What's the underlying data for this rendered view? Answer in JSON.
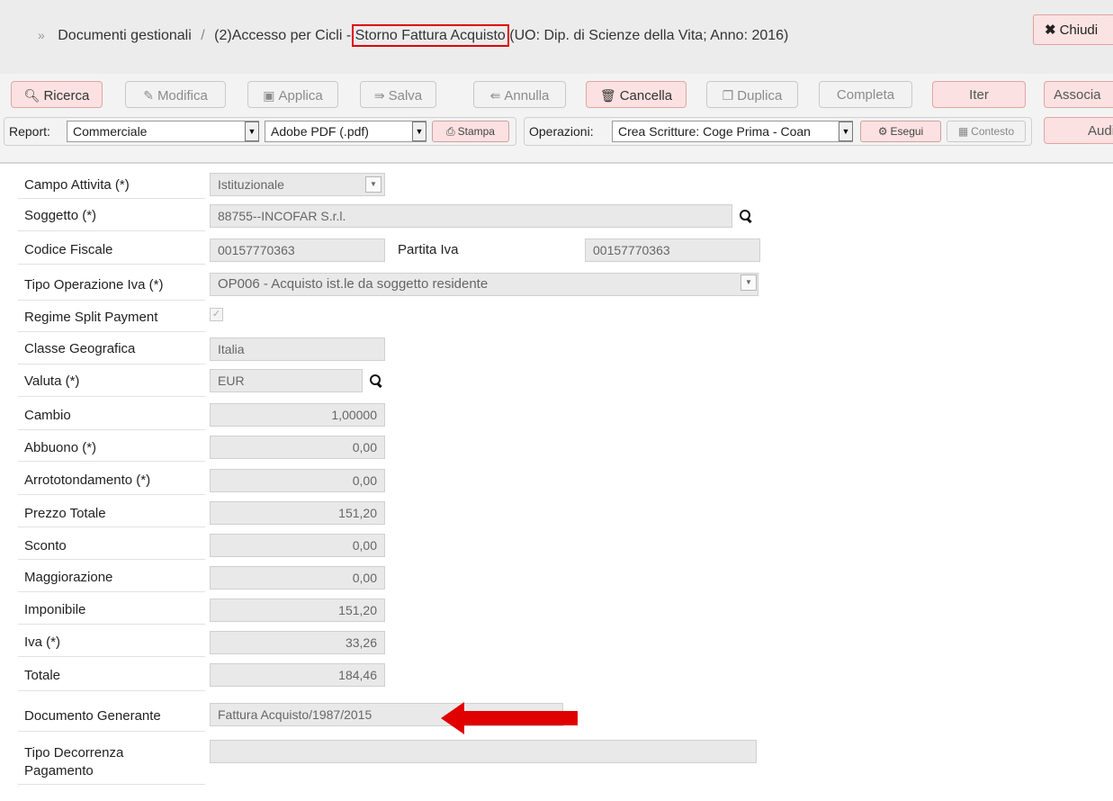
{
  "header": {
    "chevron": "»",
    "crumb1": "Documenti gestionali",
    "separator": "/",
    "crumb2": "(2)Accesso per Cicli -",
    "highlight": "Storno Fattura Acquisto",
    "crumb3": "(UO: Dip. di Scienze della Vita; Anno: 2016)",
    "close_label": "Chiudi"
  },
  "toolbar": {
    "ricerca": "Ricerca",
    "modifica": "Modifica",
    "applica": "Applica",
    "salva": "Salva",
    "annulla": "Annulla",
    "cancella": "Cancella",
    "duplica": "Duplica",
    "completa": "Completa",
    "iter": "Iter",
    "associa": "Associa",
    "report_label": "Report:",
    "report_value": "Commerciale",
    "format_value": "Adobe PDF (.pdf)",
    "stampa": "Stampa",
    "operazioni_label": "Operazioni:",
    "operazioni_value": "Crea Scritture: Coge Prima - Coan",
    "esegui": "Esegui",
    "contesto": "Contesto",
    "audit": "Audit"
  },
  "form": {
    "campo_attivita_label": "Campo Attivita (*)",
    "campo_attivita_value": "Istituzionale",
    "soggetto_label": "Soggetto (*)",
    "soggetto_value": "88755--INCOFAR S.r.l.",
    "codice_fiscale_label": "Codice Fiscale",
    "codice_fiscale_value": "00157770363",
    "partita_iva_label": "Partita Iva",
    "partita_iva_value": "00157770363",
    "tipo_operazione_label": "Tipo Operazione Iva (*)",
    "tipo_operazione_value": "OP006 - Acquisto ist.le da soggetto residente",
    "regime_split_label": "Regime Split Payment",
    "regime_split_checked": true,
    "classe_geografica_label": "Classe Geografica",
    "classe_geografica_value": "Italia",
    "valuta_label": "Valuta (*)",
    "valuta_value": "EUR",
    "cambio_label": "Cambio",
    "cambio_value": "1,00000",
    "abbuono_label": "Abbuono (*)",
    "abbuono_value": "0,00",
    "arrotondamento_label": "Arrototondamento (*)",
    "arrotondamento_value": "0,00",
    "prezzo_totale_label": "Prezzo Totale",
    "prezzo_totale_value": "151,20",
    "sconto_label": "Sconto",
    "sconto_value": "0,00",
    "maggiorazione_label": "Maggiorazione",
    "maggiorazione_value": "0,00",
    "imponibile_label": "Imponibile",
    "imponibile_value": "151,20",
    "iva_label": "Iva (*)",
    "iva_value": "33,26",
    "totale_label": "Totale",
    "totale_value": "184,46",
    "documento_generante_label": "Documento Generante",
    "documento_generante_value": "Fattura Acquisto/1987/2015",
    "tipo_decorrenza_label_1": "Tipo Decorrenza",
    "tipo_decorrenza_label_2": "Pagamento",
    "tipo_decorrenza_value": ""
  },
  "colors": {
    "highlight_box": "#e00000",
    "arrow": "#e00000",
    "active_button_bg": "#fbe1e1"
  }
}
